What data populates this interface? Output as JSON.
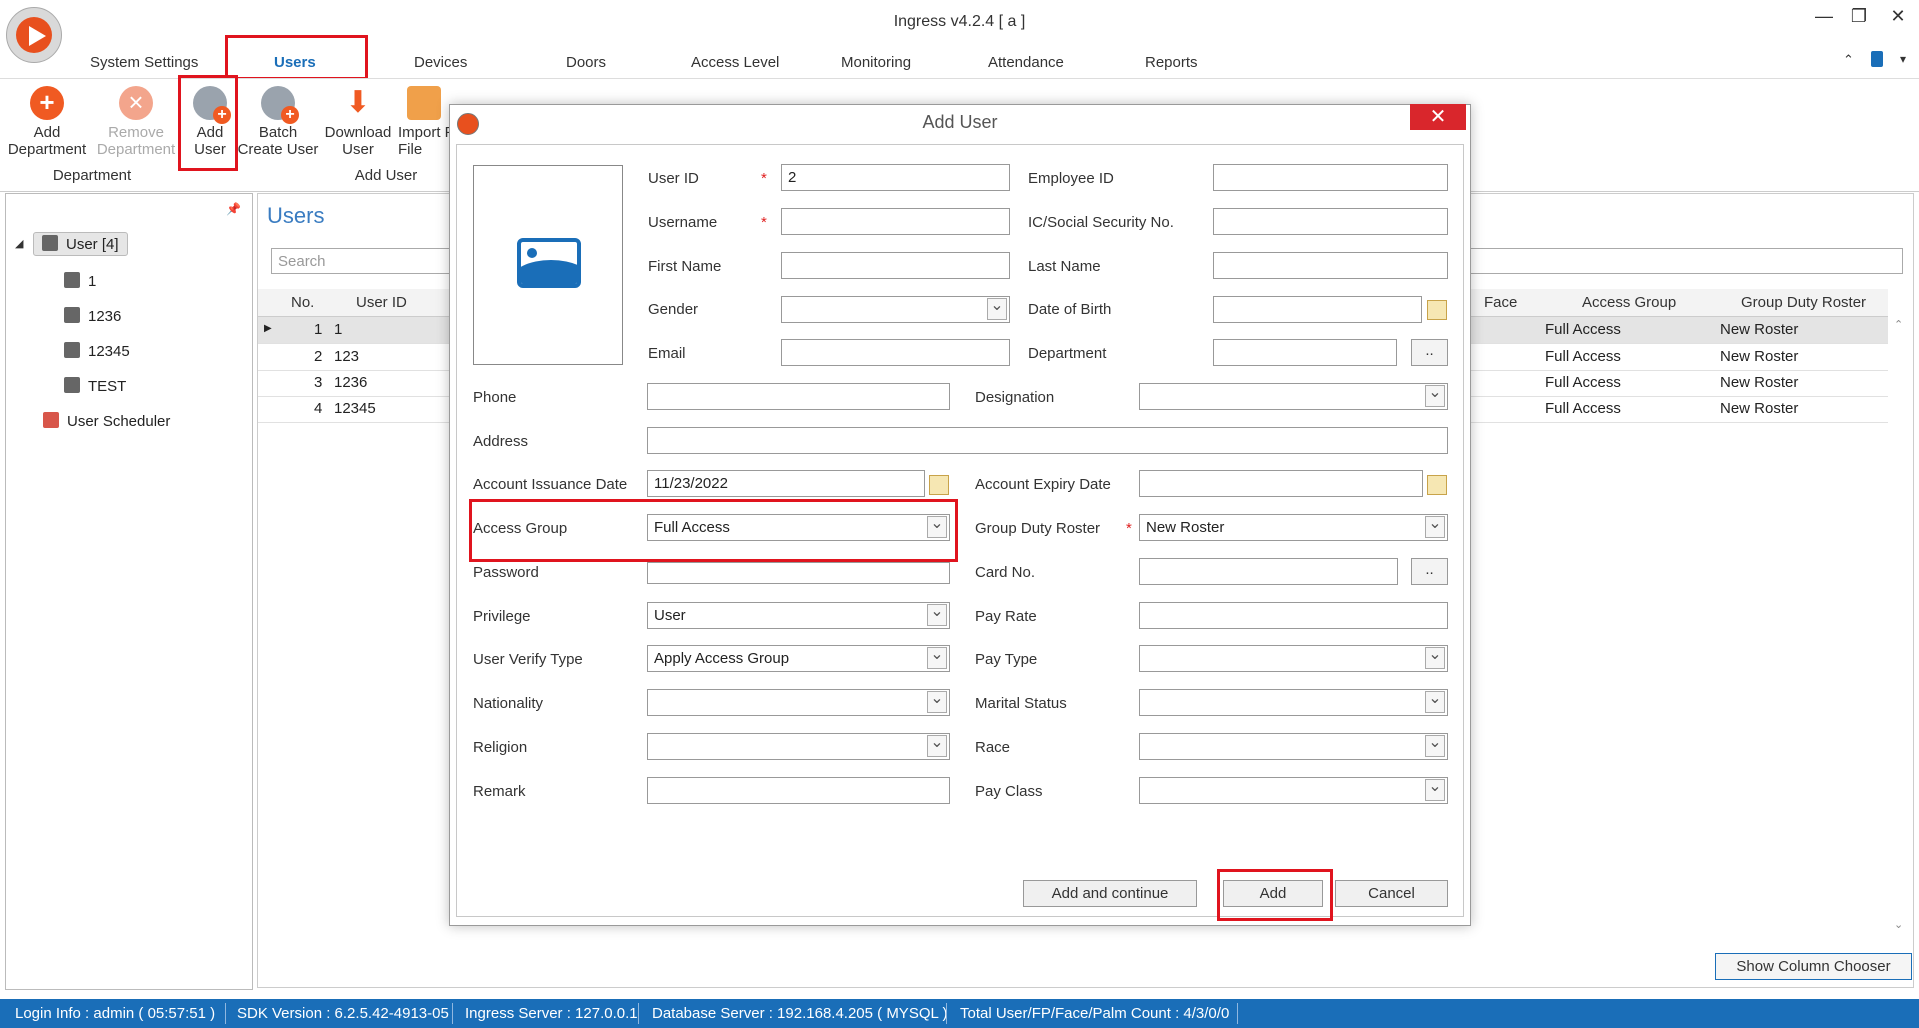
{
  "window": {
    "title": "Ingress v4.2.4 [ a ]"
  },
  "tabs": [
    "System Settings",
    "Users",
    "Devices",
    "Doors",
    "Access Level",
    "Monitoring",
    "Attendance",
    "Reports"
  ],
  "ribbon": {
    "add_department": "Add Department",
    "remove_department": "Remove Department",
    "add_user": "Add User",
    "batch_create_user": "Batch Create User",
    "download_user": "Download User",
    "import_from_file": "Import From File",
    "group_department": "Department",
    "group_add_user": "Add User"
  },
  "tree": {
    "root": "User [4]",
    "children": [
      "1",
      "1236",
      "12345",
      "TEST"
    ],
    "scheduler": "User Scheduler"
  },
  "main": {
    "title": "Users",
    "search_placeholder": "Search",
    "columns": {
      "no": "No.",
      "user_id": "User ID",
      "face": "Face",
      "access_group": "Access Group",
      "group_duty_roster": "Group Duty Roster"
    },
    "rows": [
      {
        "no": "1",
        "user_id": "1",
        "access_group": "Full Access",
        "roster": "New Roster"
      },
      {
        "no": "2",
        "user_id": "123",
        "access_group": "Full Access",
        "roster": "New Roster"
      },
      {
        "no": "3",
        "user_id": "1236",
        "access_group": "Full Access",
        "roster": "New Roster"
      },
      {
        "no": "4",
        "user_id": "12345",
        "access_group": "Full Access",
        "roster": "New Roster"
      }
    ],
    "show_column_chooser": "Show Column Chooser"
  },
  "dialog": {
    "title": "Add User",
    "labels": {
      "user_id": "User ID",
      "username": "Username",
      "first_name": "First Name",
      "gender": "Gender",
      "email": "Email",
      "employee_id": "Employee ID",
      "ic_ssn": "IC/Social Security No.",
      "last_name": "Last Name",
      "dob": "Date of Birth",
      "department": "Department",
      "phone": "Phone",
      "designation": "Designation",
      "address": "Address",
      "issuance": "Account Issuance Date",
      "expiry": "Account Expiry Date",
      "access_group": "Access Group",
      "group_duty_roster": "Group Duty Roster",
      "password": "Password",
      "card_no": "Card No.",
      "privilege": "Privilege",
      "pay_rate": "Pay Rate",
      "verify_type": "User Verify Type",
      "pay_type": "Pay Type",
      "nationality": "Nationality",
      "marital_status": "Marital Status",
      "religion": "Religion",
      "race": "Race",
      "remark": "Remark",
      "pay_class": "Pay Class"
    },
    "values": {
      "user_id": "2",
      "issuance": "11/23/2022",
      "access_group": "Full Access",
      "group_duty_roster": "New Roster",
      "privilege": "User",
      "verify_type": "Apply Access Group"
    },
    "required_mark": "*",
    "dots": "..",
    "buttons": {
      "add_continue": "Add and continue",
      "add": "Add",
      "cancel": "Cancel"
    },
    "close": "✕"
  },
  "status": {
    "login": "Login Info : admin ( 05:57:51 )",
    "sdk": "SDK Version : 6.2.5.42-4913-05",
    "server": "Ingress Server : 127.0.0.1",
    "db": "Database Server : 192.168.4.205 ( MYSQL )",
    "total": "Total User/FP/Face/Palm Count : 4/3/0/0"
  },
  "colors": {
    "accent": "#1a6eb8",
    "highlight": "#e0141e",
    "orange": "#f05a22"
  }
}
